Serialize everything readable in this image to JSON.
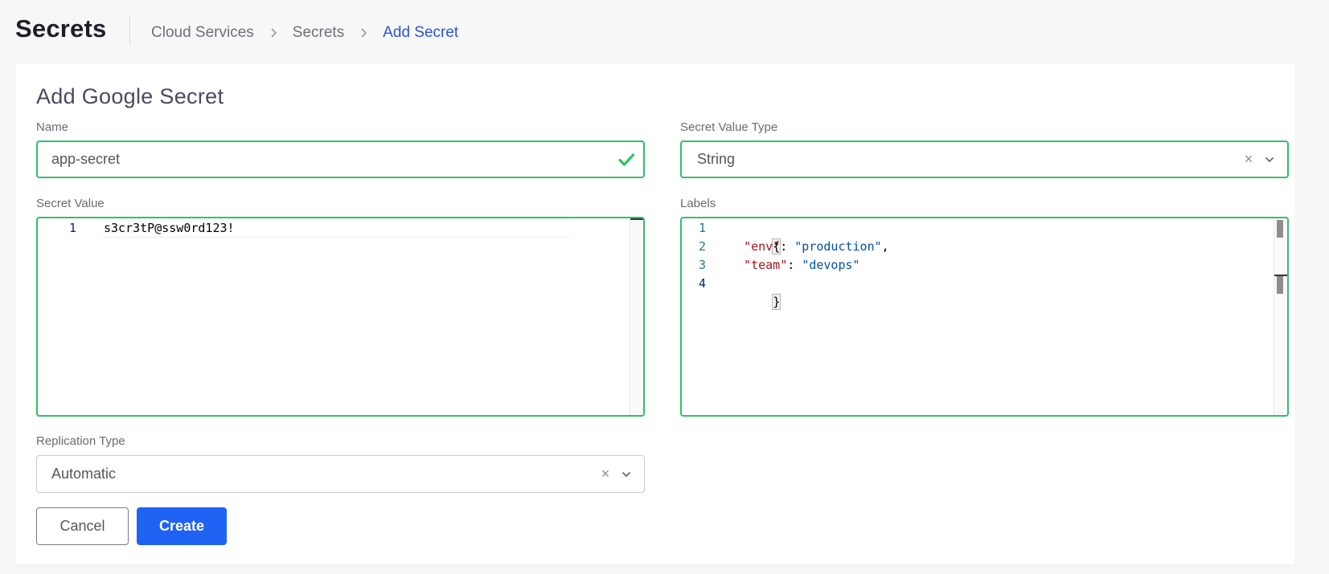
{
  "header": {
    "title": "Secrets",
    "breadcrumb": [
      "Cloud Services",
      "Secrets",
      "Add Secret"
    ]
  },
  "form": {
    "title": "Add Google Secret",
    "name": {
      "label": "Name",
      "value": "app-secret"
    },
    "secret_value_type": {
      "label": "Secret Value Type",
      "value": "String"
    },
    "secret_value": {
      "label": "Secret Value",
      "lines": [
        "s3cr3tP@ssw0rd123!"
      ]
    },
    "labels": {
      "label": "Labels",
      "line_numbers": [
        "1",
        "2",
        "3",
        "4"
      ],
      "open_brace": "{",
      "close_brace": "}",
      "entries": [
        {
          "key": "\"env\"",
          "value": "\"production\"",
          "trailing": ","
        },
        {
          "key": "\"team\"",
          "value": "\"devops\"",
          "trailing": ""
        }
      ]
    },
    "replication_type": {
      "label": "Replication Type",
      "value": "Automatic"
    },
    "clear_glyph": "×",
    "buttons": {
      "cancel": "Cancel",
      "create": "Create"
    }
  },
  "colors": {
    "accent": "#1f63f5",
    "valid_border": "#31c06a",
    "breadcrumb_active": "#2b54d6"
  }
}
